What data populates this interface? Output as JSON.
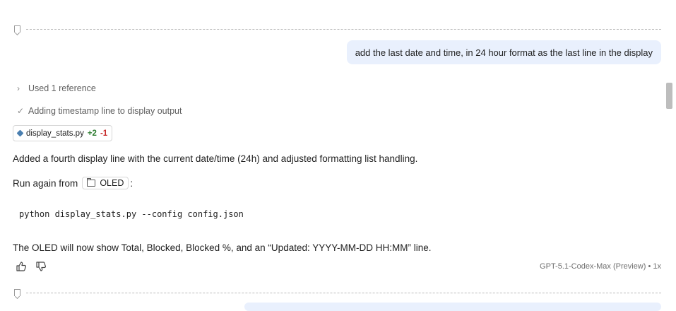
{
  "conversation": {
    "user_message": "add the last date and time, in 24 hour format as the last line in the display",
    "references_label": "Used 1 reference",
    "step_label": "Adding timestamp line to display output",
    "file_change": {
      "filename": "display_stats.py",
      "additions": "+2",
      "deletions": "-1"
    },
    "response_paragraph_1": "Added a fourth display line with the current date/time (24h) and adjusted formatting list handling.",
    "run_again_prefix": "Run again from",
    "run_again_folder": "OLED",
    "run_again_suffix": ":",
    "code_command": "python display_stats.py --config config.json",
    "response_paragraph_2": "The OLED will now show Total, Blocked, Blocked %, and an “Updated: YYYY-MM-DD HH:MM” line.",
    "model_label": "GPT-5.1-Codex-Max (Preview) • 1x"
  },
  "icons": {
    "bookmark": "bookmark-icon",
    "chevron": "chevron-right-icon",
    "check": "check-icon",
    "python_file": "python-file-icon",
    "folder": "folder-icon",
    "thumbs_up": "thumbs-up-icon",
    "thumbs_down": "thumbs-down-icon"
  },
  "colors": {
    "user_bubble_bg": "#e9f0fd",
    "additions": "#2e7d32",
    "deletions": "#c62828"
  }
}
